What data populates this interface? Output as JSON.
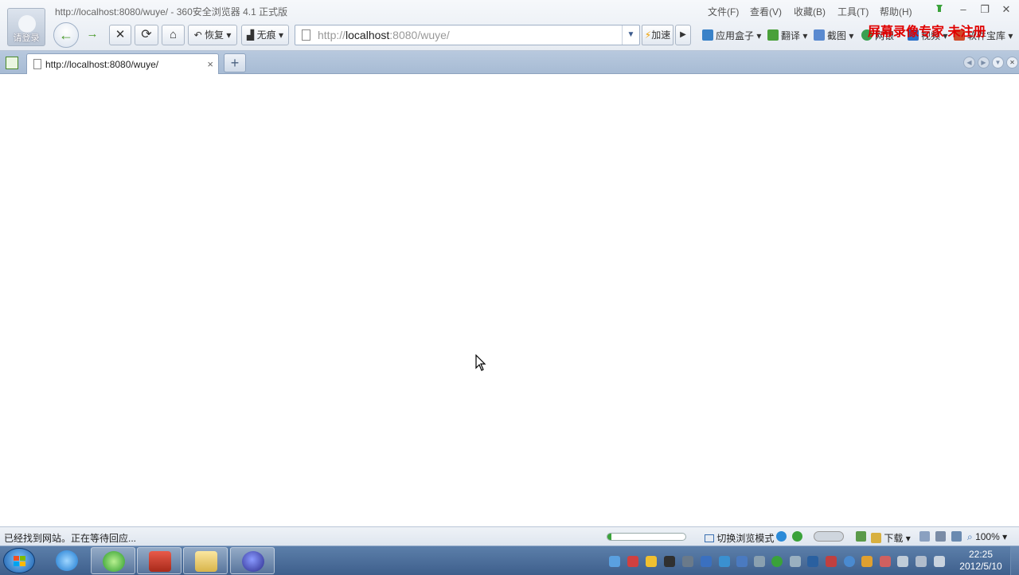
{
  "browser": {
    "window_title": "http://localhost:8080/wuye/ - 360安全浏览器 4.1 正式版",
    "login_label": "请登录",
    "menus": [
      "文件(F)",
      "查看(V)",
      "收藏(B)",
      "工具(T)",
      "帮助(H)"
    ],
    "toolbar": {
      "restore_label": "恢复",
      "incognito_label": "无痕",
      "address_prefix": "http://",
      "address_host": "localhost",
      "address_rest": ":8080/wuye/",
      "accelerate_label": "加速",
      "tools": [
        "应用盒子",
        "翻译",
        "截图",
        "网银",
        "视频",
        "软件宝库"
      ]
    },
    "watermark": "屏幕录像专家 未注册",
    "tab": {
      "title": "http://localhost:8080/wuye/",
      "close": "×",
      "new": "+"
    }
  },
  "statusbar": {
    "status_text": "已经找到网站。正在等待回应...",
    "progress_fraction": 0.05,
    "mode_label": "切换浏览模式",
    "download_label": "下载",
    "zoom_label": "100%"
  },
  "taskbar": {
    "time": "22:25",
    "date": "2012/5/10"
  },
  "colors": {
    "chrome_bg": "#e6ebf2",
    "tab_strip": "#a7bbd4",
    "watermark": "#e00000",
    "taskbar": "#3e5f8c"
  }
}
